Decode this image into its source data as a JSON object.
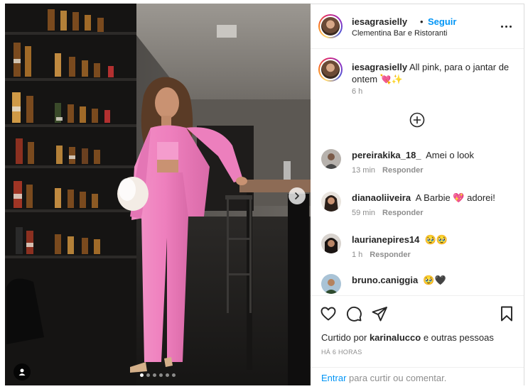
{
  "header": {
    "username": "iesagrasielly",
    "separator": "•",
    "follow_label": "Seguir",
    "location": "Clementina Bar e Ristoranti"
  },
  "caption": {
    "username": "iesagrasielly",
    "text": "All pink, para o jantar de ontem 💘✨",
    "time": "6 h"
  },
  "comments": [
    {
      "username": "pereirakika_18_",
      "text": "Amei o look",
      "time": "13 min",
      "reply_label": "Responder"
    },
    {
      "username": "dianaoliiveira",
      "text": "A Barbie 💖 adorei!",
      "time": "59 min",
      "reply_label": "Responder"
    },
    {
      "username": "laurianepires14",
      "text": "🥹🥹",
      "time": "1 h",
      "reply_label": "Responder"
    },
    {
      "username": "bruno.caniggia",
      "text": "🥹🖤",
      "time": "",
      "reply_label": ""
    }
  ],
  "likes": {
    "prefix": "Curtido por",
    "user": "karinalucco",
    "suffix": "e outras pessoas"
  },
  "post_date": "HÁ 6 HORAS",
  "login_prompt": {
    "link": "Entrar",
    "text": "para curtir ou comentar."
  },
  "carousel": {
    "total_slides": 6,
    "active_index": 0
  },
  "icons": {
    "like": "heart-icon",
    "comment": "comment-icon",
    "share": "send-icon",
    "save": "bookmark-icon",
    "more": "more-options-icon",
    "load_more": "plus-circle-icon",
    "next": "chevron-right-icon",
    "tags": "user-tag-icon"
  },
  "colors": {
    "link": "#0095f6",
    "muted": "#8e8e8e",
    "text": "#262626",
    "border": "#dbdbdb"
  }
}
